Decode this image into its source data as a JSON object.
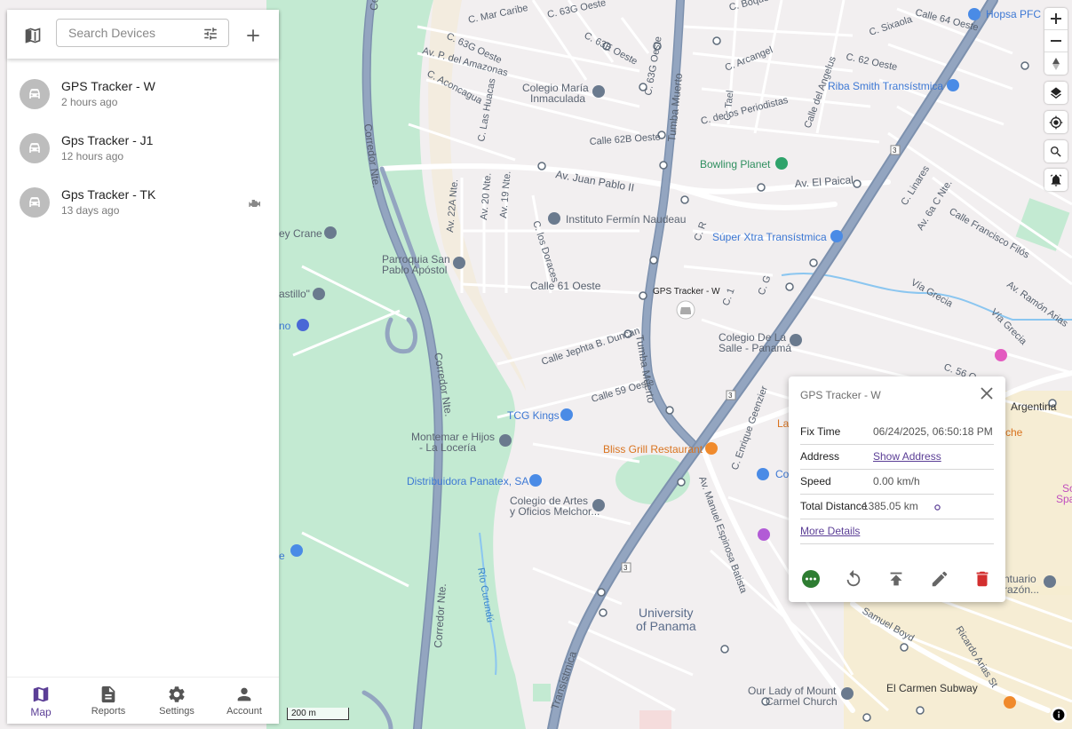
{
  "toolbar": {
    "search_placeholder": "Search Devices",
    "map_toggle_icon": "map-icon",
    "filter_icon": "tune-icon",
    "add_icon": "plus-icon"
  },
  "devices": [
    {
      "name": "GPS Tracker - W",
      "last_update": "2 hours ago",
      "icon": "car-icon"
    },
    {
      "name": "Gps Tracker - J1",
      "last_update": "12 hours ago",
      "icon": "car-icon"
    },
    {
      "name": "Gps Tracker - TK",
      "last_update": "13 days ago",
      "icon": "car-icon",
      "status_icon": "engine-icon"
    }
  ],
  "bottom_nav": [
    {
      "label": "Map",
      "icon": "map-icon",
      "active": true
    },
    {
      "label": "Reports",
      "icon": "report-icon",
      "active": false
    },
    {
      "label": "Settings",
      "icon": "gear-icon",
      "active": false
    },
    {
      "label": "Account",
      "icon": "person-icon",
      "active": false
    }
  ],
  "popup": {
    "title": "GPS Tracker - W",
    "fix_time_label": "Fix Time",
    "fix_time": "06/24/2025, 06:50:18 PM",
    "address_label": "Address",
    "address_link": "Show Address",
    "speed_label": "Speed",
    "speed": "0.00 km/h",
    "distance_label": "Total Distance",
    "distance": "1385.05 km",
    "more_details": "More Details"
  },
  "map": {
    "scale": "200 m",
    "marker_label": "GPS Tracker - W",
    "streets": {
      "s1": "C. Mar Caribe",
      "s2": "C. 63G Oeste",
      "s3": "C. 63E Oeste",
      "s4": "C. 63G Oeste",
      "s5": "Av. P. del Amazonas",
      "s6": "C. Aconcagua",
      "s7": "C. 63G Oeste",
      "s8": "C. 63G Oeste",
      "s9": "C. Arcangel",
      "s10": "C. 62 Oeste",
      "s11": "C. Sixaola",
      "s12": "Calle 64 Oeste",
      "s13": "C. Boquete",
      "s14": "C. Las Huacas",
      "s15": "C. Tael",
      "s16": "C. de los Periodistas",
      "s17": "Calle del Angelus",
      "s18": "Calle 62B Oeste",
      "s19": "Tumba Muerto",
      "s20": "Av. Juan Pablo II",
      "s21": "Av. El Paical",
      "s22": "Av. 22A Nte.",
      "s23": "Av. 20 Nte.",
      "s24": "Av. 19 Nte.",
      "s25": "C. los Doraces",
      "s26": "Calle 61 Oeste",
      "s27": "C. R",
      "s28": "C. 1",
      "s29": "C. G",
      "s30": "Calle Jephta B. Duncan",
      "s31": "Calle 59 Oeste",
      "s32": "Tumba Muerto",
      "s33": "Corredor Nte.",
      "s34": "Corredor Nte.",
      "s35": "Corredor Nte.",
      "s36": "Corredor Nte.",
      "s37": "C. Linares",
      "s38": "Av. 6a C Nte.",
      "s39": "Calle Francisco Filós",
      "s40": "Vía Grecia",
      "s41": "Vía Grecia",
      "s42": "Av. Ramón Arias",
      "s43": "C. 56 O",
      "s44": "C. Enrique Geenzier",
      "s45": "Av. Manuel Espinosa Batista",
      "s46": "Transístmica",
      "s47": "Samuel Boyd",
      "s48": "Ricardo Arias St",
      "s49": "Río Curundú",
      "s50": "3"
    },
    "pois": {
      "p1": "Hopsa PFC",
      "p2": "Riba Smith Transístmica",
      "p3": "Colegio María",
      "p3b": "Inmaculada",
      "p4": "Bowling Planet",
      "p5": "Instituto Fermín Naudeau",
      "p6": "Súper Xtra Transístmica",
      "p7": "ey Crane",
      "p8": "Parroquia San",
      "p8b": "Pablo Apóstol",
      "p9": "astillo\"",
      "p10": "no",
      "p11": "Colegio De La",
      "p11b": "Salle - Panamá",
      "p12": "TCG Kings",
      "p13": "Montemar e Hijos",
      "p13b": "- La Locería",
      "p14": "Bliss Grill Restaurant",
      "p15": "Distribuidora Panatex, SA",
      "p16": "Colegio de Artes",
      "p16b": "y Oficios Melchor...",
      "p17": "University",
      "p17b": "of Panama",
      "p18": "Our Lady of Mount",
      "p18b": "Carmel Church",
      "p19": "El Carmen Subway",
      "p20": "Argentina",
      "p21": "Co",
      "p22": "La",
      "p23": "che",
      "p24": "So",
      "p24b": "Spa",
      "p25": "ntuario",
      "p25b": "razón...",
      "p26": "e"
    }
  }
}
